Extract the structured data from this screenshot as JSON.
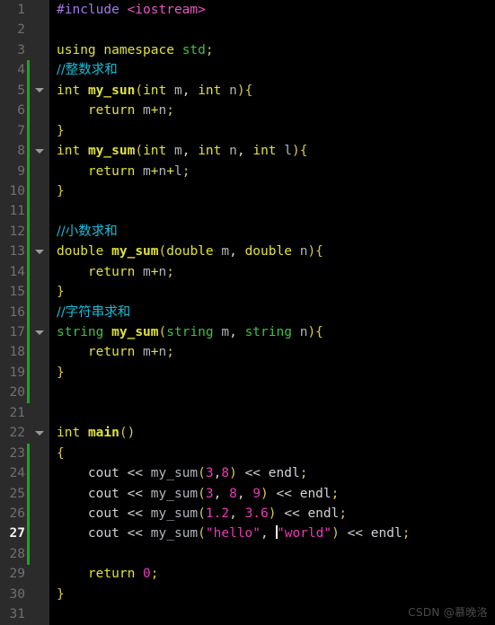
{
  "editor": {
    "theme": "dark",
    "language": "cpp",
    "background": "#000000",
    "gutter_background": "#2b2b2b",
    "change_bar_color": "#1aa81a",
    "active_line": 27,
    "first_line": 1,
    "last_line": 31,
    "total_lines": 31
  },
  "colors": {
    "preprocessor": "#a37ae8",
    "include_header": "#e855c0",
    "keyword": "#e2e234",
    "type": "#3fc13f",
    "function_name": "#e2e234",
    "variable": "#b0b4bc",
    "number": "#e83ab8",
    "string": "#e83ab8",
    "comment": "#16bdd8",
    "paren": "#d8c84a",
    "line_number": "#707070",
    "line_number_active": "#f2f2f2",
    "caret": "#ffffff",
    "watermark": "#4a4a4a"
  },
  "gutter": {
    "line_numbers": [
      1,
      2,
      3,
      4,
      5,
      6,
      7,
      8,
      9,
      10,
      11,
      12,
      13,
      14,
      15,
      16,
      17,
      18,
      19,
      20,
      21,
      22,
      23,
      24,
      25,
      26,
      27,
      28,
      29,
      30,
      31
    ],
    "fold_arrow_lines": [
      5,
      8,
      13,
      17,
      22
    ],
    "fold_arrow_icon": "chevron-down-icon",
    "change_bar_ranges": [
      [
        4,
        20
      ],
      [
        23,
        28
      ]
    ]
  },
  "code_lines": [
    {
      "n": 1,
      "tokens": [
        {
          "t": "#include",
          "c": "t-pre"
        },
        {
          "t": " ",
          "c": "t-plain"
        },
        {
          "t": "<iostream>",
          "c": "t-inc"
        }
      ]
    },
    {
      "n": 2,
      "tokens": []
    },
    {
      "n": 3,
      "tokens": [
        {
          "t": "using",
          "c": "t-kw"
        },
        {
          "t": " ",
          "c": "t-plain"
        },
        {
          "t": "namespace",
          "c": "t-kw"
        },
        {
          "t": " ",
          "c": "t-plain"
        },
        {
          "t": "std",
          "c": "t-type"
        },
        {
          "t": ";",
          "c": "t-par"
        }
      ]
    },
    {
      "n": 4,
      "tokens": [
        {
          "t": "//整数求和",
          "c": "t-cmt cjk"
        }
      ]
    },
    {
      "n": 5,
      "tokens": [
        {
          "t": "int",
          "c": "t-kw"
        },
        {
          "t": " ",
          "c": "t-plain"
        },
        {
          "t": "my_sun",
          "c": "t-fn"
        },
        {
          "t": "(",
          "c": "t-par"
        },
        {
          "t": "int",
          "c": "t-kw"
        },
        {
          "t": " ",
          "c": "t-plain"
        },
        {
          "t": "m",
          "c": "t-var"
        },
        {
          "t": ", ",
          "c": "t-punc"
        },
        {
          "t": "int",
          "c": "t-kw"
        },
        {
          "t": " ",
          "c": "t-plain"
        },
        {
          "t": "n",
          "c": "t-var"
        },
        {
          "t": "){",
          "c": "t-par"
        }
      ]
    },
    {
      "n": 6,
      "tokens": [
        {
          "t": "    ",
          "c": "t-plain"
        },
        {
          "t": "return",
          "c": "t-kw"
        },
        {
          "t": " ",
          "c": "t-plain"
        },
        {
          "t": "m",
          "c": "t-var"
        },
        {
          "t": "+",
          "c": "t-kw"
        },
        {
          "t": "n",
          "c": "t-var"
        },
        {
          "t": ";",
          "c": "t-par"
        }
      ]
    },
    {
      "n": 7,
      "tokens": [
        {
          "t": "}",
          "c": "t-par"
        }
      ]
    },
    {
      "n": 8,
      "tokens": [
        {
          "t": "int",
          "c": "t-kw"
        },
        {
          "t": " ",
          "c": "t-plain"
        },
        {
          "t": "my_sum",
          "c": "t-fn"
        },
        {
          "t": "(",
          "c": "t-par"
        },
        {
          "t": "int",
          "c": "t-kw"
        },
        {
          "t": " ",
          "c": "t-plain"
        },
        {
          "t": "m",
          "c": "t-var"
        },
        {
          "t": ", ",
          "c": "t-punc"
        },
        {
          "t": "int",
          "c": "t-kw"
        },
        {
          "t": " ",
          "c": "t-plain"
        },
        {
          "t": "n",
          "c": "t-var"
        },
        {
          "t": ", ",
          "c": "t-punc"
        },
        {
          "t": "int",
          "c": "t-kw"
        },
        {
          "t": " ",
          "c": "t-plain"
        },
        {
          "t": "l",
          "c": "t-var"
        },
        {
          "t": "){",
          "c": "t-par"
        }
      ]
    },
    {
      "n": 9,
      "tokens": [
        {
          "t": "    ",
          "c": "t-plain"
        },
        {
          "t": "return",
          "c": "t-kw"
        },
        {
          "t": " ",
          "c": "t-plain"
        },
        {
          "t": "m",
          "c": "t-var"
        },
        {
          "t": "+",
          "c": "t-kw"
        },
        {
          "t": "n",
          "c": "t-var"
        },
        {
          "t": "+",
          "c": "t-kw"
        },
        {
          "t": "l",
          "c": "t-var"
        },
        {
          "t": ";",
          "c": "t-par"
        }
      ]
    },
    {
      "n": 10,
      "tokens": [
        {
          "t": "}",
          "c": "t-par"
        }
      ]
    },
    {
      "n": 11,
      "tokens": []
    },
    {
      "n": 12,
      "tokens": [
        {
          "t": "//小数求和",
          "c": "t-cmt cjk"
        }
      ]
    },
    {
      "n": 13,
      "tokens": [
        {
          "t": "double",
          "c": "t-kw"
        },
        {
          "t": " ",
          "c": "t-plain"
        },
        {
          "t": "my_sum",
          "c": "t-fn"
        },
        {
          "t": "(",
          "c": "t-par"
        },
        {
          "t": "double",
          "c": "t-kw"
        },
        {
          "t": " ",
          "c": "t-plain"
        },
        {
          "t": "m",
          "c": "t-var"
        },
        {
          "t": ", ",
          "c": "t-punc"
        },
        {
          "t": "double",
          "c": "t-kw"
        },
        {
          "t": " ",
          "c": "t-plain"
        },
        {
          "t": "n",
          "c": "t-var"
        },
        {
          "t": "){",
          "c": "t-par"
        }
      ]
    },
    {
      "n": 14,
      "tokens": [
        {
          "t": "    ",
          "c": "t-plain"
        },
        {
          "t": "return",
          "c": "t-kw"
        },
        {
          "t": " ",
          "c": "t-plain"
        },
        {
          "t": "m",
          "c": "t-var"
        },
        {
          "t": "+",
          "c": "t-kw"
        },
        {
          "t": "n",
          "c": "t-var"
        },
        {
          "t": ";",
          "c": "t-par"
        }
      ]
    },
    {
      "n": 15,
      "tokens": [
        {
          "t": "}",
          "c": "t-par"
        }
      ]
    },
    {
      "n": 16,
      "tokens": [
        {
          "t": "//字符串求和",
          "c": "t-cmt cjk"
        }
      ]
    },
    {
      "n": 17,
      "tokens": [
        {
          "t": "string",
          "c": "t-type"
        },
        {
          "t": " ",
          "c": "t-plain"
        },
        {
          "t": "my_sum",
          "c": "t-fn"
        },
        {
          "t": "(",
          "c": "t-par"
        },
        {
          "t": "string",
          "c": "t-type"
        },
        {
          "t": " ",
          "c": "t-plain"
        },
        {
          "t": "m",
          "c": "t-var"
        },
        {
          "t": ", ",
          "c": "t-punc"
        },
        {
          "t": "string",
          "c": "t-type"
        },
        {
          "t": " ",
          "c": "t-plain"
        },
        {
          "t": "n",
          "c": "t-var"
        },
        {
          "t": "){",
          "c": "t-par"
        }
      ]
    },
    {
      "n": 18,
      "tokens": [
        {
          "t": "    ",
          "c": "t-plain"
        },
        {
          "t": "return",
          "c": "t-kw"
        },
        {
          "t": " ",
          "c": "t-plain"
        },
        {
          "t": "m",
          "c": "t-var"
        },
        {
          "t": "+",
          "c": "t-kw"
        },
        {
          "t": "n",
          "c": "t-var"
        },
        {
          "t": ";",
          "c": "t-par"
        }
      ]
    },
    {
      "n": 19,
      "tokens": [
        {
          "t": "}",
          "c": "t-par"
        }
      ]
    },
    {
      "n": 20,
      "tokens": []
    },
    {
      "n": 21,
      "tokens": []
    },
    {
      "n": 22,
      "tokens": [
        {
          "t": "int",
          "c": "t-kw"
        },
        {
          "t": " ",
          "c": "t-plain"
        },
        {
          "t": "main",
          "c": "t-fn"
        },
        {
          "t": "()",
          "c": "t-par"
        }
      ]
    },
    {
      "n": 23,
      "tokens": [
        {
          "t": "{",
          "c": "t-par"
        }
      ]
    },
    {
      "n": 24,
      "tokens": [
        {
          "t": "    ",
          "c": "t-plain"
        },
        {
          "t": "cout",
          "c": "t-plain"
        },
        {
          "t": " ",
          "c": "t-plain"
        },
        {
          "t": "<<",
          "c": "t-plain"
        },
        {
          "t": " ",
          "c": "t-plain"
        },
        {
          "t": "my_sum",
          "c": "t-var"
        },
        {
          "t": "(",
          "c": "t-par"
        },
        {
          "t": "3",
          "c": "t-num"
        },
        {
          "t": ",",
          "c": "t-punc"
        },
        {
          "t": "8",
          "c": "t-num"
        },
        {
          "t": ")",
          "c": "t-par"
        },
        {
          "t": " ",
          "c": "t-plain"
        },
        {
          "t": "<<",
          "c": "t-plain"
        },
        {
          "t": " ",
          "c": "t-plain"
        },
        {
          "t": "endl",
          "c": "t-plain"
        },
        {
          "t": ";",
          "c": "t-par"
        }
      ]
    },
    {
      "n": 25,
      "tokens": [
        {
          "t": "    ",
          "c": "t-plain"
        },
        {
          "t": "cout",
          "c": "t-plain"
        },
        {
          "t": " ",
          "c": "t-plain"
        },
        {
          "t": "<<",
          "c": "t-plain"
        },
        {
          "t": " ",
          "c": "t-plain"
        },
        {
          "t": "my_sum",
          "c": "t-var"
        },
        {
          "t": "(",
          "c": "t-par"
        },
        {
          "t": "3",
          "c": "t-num"
        },
        {
          "t": ", ",
          "c": "t-punc"
        },
        {
          "t": "8",
          "c": "t-num"
        },
        {
          "t": ", ",
          "c": "t-punc"
        },
        {
          "t": "9",
          "c": "t-num"
        },
        {
          "t": ")",
          "c": "t-par"
        },
        {
          "t": " ",
          "c": "t-plain"
        },
        {
          "t": "<<",
          "c": "t-plain"
        },
        {
          "t": " ",
          "c": "t-plain"
        },
        {
          "t": "endl",
          "c": "t-plain"
        },
        {
          "t": ";",
          "c": "t-par"
        }
      ]
    },
    {
      "n": 26,
      "tokens": [
        {
          "t": "    ",
          "c": "t-plain"
        },
        {
          "t": "cout",
          "c": "t-plain"
        },
        {
          "t": " ",
          "c": "t-plain"
        },
        {
          "t": "<<",
          "c": "t-plain"
        },
        {
          "t": " ",
          "c": "t-plain"
        },
        {
          "t": "my_sum",
          "c": "t-var"
        },
        {
          "t": "(",
          "c": "t-par"
        },
        {
          "t": "1.2",
          "c": "t-num"
        },
        {
          "t": ", ",
          "c": "t-punc"
        },
        {
          "t": "3.6",
          "c": "t-num"
        },
        {
          "t": ")",
          "c": "t-par"
        },
        {
          "t": " ",
          "c": "t-plain"
        },
        {
          "t": "<<",
          "c": "t-plain"
        },
        {
          "t": " ",
          "c": "t-plain"
        },
        {
          "t": "endl",
          "c": "t-plain"
        },
        {
          "t": ";",
          "c": "t-par"
        }
      ]
    },
    {
      "n": 27,
      "tokens": [
        {
          "t": "    ",
          "c": "t-plain"
        },
        {
          "t": "cout",
          "c": "t-plain"
        },
        {
          "t": " ",
          "c": "t-plain"
        },
        {
          "t": "<<",
          "c": "t-plain"
        },
        {
          "t": " ",
          "c": "t-plain"
        },
        {
          "t": "my_sum",
          "c": "t-var"
        },
        {
          "t": "(",
          "c": "t-par"
        },
        {
          "t": "\"hello\"",
          "c": "t-str"
        },
        {
          "t": ", ",
          "c": "t-punc"
        },
        {
          "t": "CARET",
          "c": "caret"
        },
        {
          "t": "\"world\"",
          "c": "t-str"
        },
        {
          "t": ")",
          "c": "t-par"
        },
        {
          "t": " ",
          "c": "t-plain"
        },
        {
          "t": "<<",
          "c": "t-plain"
        },
        {
          "t": " ",
          "c": "t-plain"
        },
        {
          "t": "endl",
          "c": "t-plain"
        },
        {
          "t": ";",
          "c": "t-par"
        }
      ]
    },
    {
      "n": 28,
      "tokens": []
    },
    {
      "n": 29,
      "tokens": [
        {
          "t": "    ",
          "c": "t-plain"
        },
        {
          "t": "return",
          "c": "t-kw"
        },
        {
          "t": " ",
          "c": "t-plain"
        },
        {
          "t": "0",
          "c": "t-num"
        },
        {
          "t": ";",
          "c": "t-par"
        }
      ]
    },
    {
      "n": 30,
      "tokens": [
        {
          "t": "}",
          "c": "t-par"
        }
      ]
    },
    {
      "n": 31,
      "tokens": []
    }
  ],
  "watermark": {
    "text": "CSDN @慕晚洛"
  }
}
